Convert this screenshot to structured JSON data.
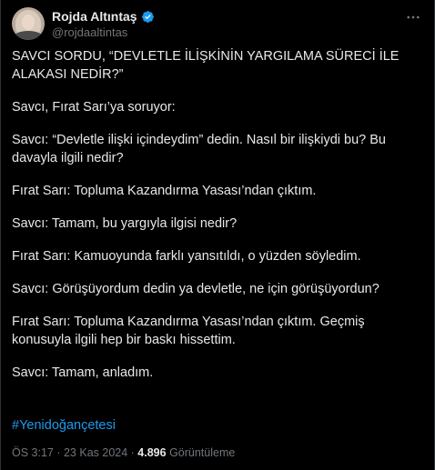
{
  "author": {
    "display_name": "Rojda Altıntaş",
    "handle": "@rojdaaltintas",
    "verified_icon": "verified-badge-icon",
    "avatar_icon": "profile-avatar"
  },
  "menu_icon": "more-options-icon",
  "tweet": {
    "paragraphs": [
      "SAVCI SORDU, “DEVLETLE İLİŞKİNİN YARGILAMA SÜRECİ İLE ALAKASI NEDİR?”",
      "Savcı, Fırat Sarı’ya soruyor:",
      "Savcı: “Devletle ilişki içindeydim” dedin. Nasıl bir ilişkiydi bu? Bu davayla ilgili nedir?",
      "Fırat Sarı: Topluma Kazandırma Yasası’ndan çıktım.",
      "Savcı: Tamam, bu yargıyla ilgisi nedir?",
      "Fırat Sarı: Kamuoyunda farklı yansıtıldı, o yüzden söyledim.",
      "Savcı: Görüşüyordum dedin ya devletle, ne için görüşüyordun?",
      "Fırat Sarı: Topluma Kazandırma Yasası’ndan çıktım. Geçmiş konusuyla ilgili hep bir baskı hissettim.",
      "Savcı: Tamam, anladım."
    ],
    "hashtag": "#Yenidoğançetesi"
  },
  "meta": {
    "time": "ÖS 3:17",
    "separator": " · ",
    "date": "23 Kas 2024",
    "views_count": "4.896",
    "views_label": "Görüntüleme"
  },
  "colors": {
    "background": "#000000",
    "text": "#e7e9ea",
    "secondary_text": "#71767b",
    "link": "#1d9bf0",
    "verified": "#1d9bf0"
  }
}
